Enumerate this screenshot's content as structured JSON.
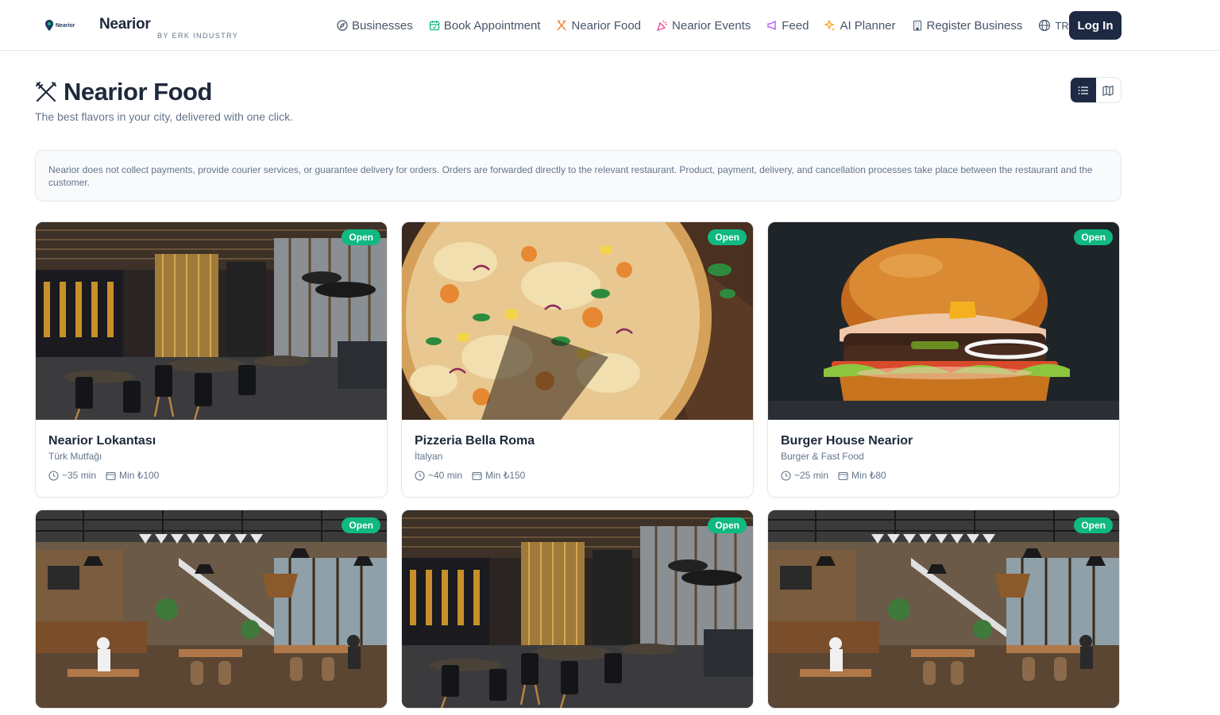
{
  "header": {
    "brand": "Nearior",
    "brand_sub": "BY ERK INDUSTRY",
    "logo_text": "Nearior",
    "nav": [
      {
        "label": "Businesses",
        "icon": "compass-icon",
        "color": "#475569"
      },
      {
        "label": "Book Appointment",
        "icon": "calendar-icon",
        "color": "#10b981"
      },
      {
        "label": "Nearior Food",
        "icon": "utensils-icon",
        "color": "#f97316"
      },
      {
        "label": "Nearior Events",
        "icon": "party-icon",
        "color": "#ec4899"
      },
      {
        "label": "Feed",
        "icon": "megaphone-icon",
        "color": "#a855f7"
      },
      {
        "label": "AI Planner",
        "icon": "sparkles-icon",
        "color": "#f59e0b"
      },
      {
        "label": "Register Business",
        "icon": "building-icon",
        "color": "#64748b"
      }
    ],
    "lang": "TR",
    "login": "Log In"
  },
  "page": {
    "title": "Nearior Food",
    "subtitle": "The best flavors in your city, delivered with one click.",
    "notice": "Nearior does not collect payments, provide courier services, or guarantee delivery for orders. Orders are forwarded directly to the relevant restaurant. Product, payment, delivery, and cancellation processes take place between the restaurant and the customer."
  },
  "colors": {
    "primary": "#1e2a44",
    "open_badge": "#10b981"
  },
  "restaurants": [
    {
      "name": "Nearior Lokantası",
      "cuisine": "Türk Mutfağı",
      "time": "~35 min",
      "min": "Min ₺100",
      "status": "Open",
      "image": "restaurant-interior"
    },
    {
      "name": "Pizzeria Bella Roma",
      "cuisine": "İtalyan",
      "time": "~40 min",
      "min": "Min ₺150",
      "status": "Open",
      "image": "pizza"
    },
    {
      "name": "Burger House Nearior",
      "cuisine": "Burger & Fast Food",
      "time": "~25 min",
      "min": "Min ₺80",
      "status": "Open",
      "image": "burger"
    },
    {
      "name": "",
      "cuisine": "",
      "time": "",
      "min": "",
      "status": "Open",
      "image": "cafe-interior"
    },
    {
      "name": "",
      "cuisine": "",
      "time": "",
      "min": "",
      "status": "Open",
      "image": "restaurant-interior"
    },
    {
      "name": "",
      "cuisine": "",
      "time": "",
      "min": "",
      "status": "Open",
      "image": "cafe-interior"
    }
  ]
}
